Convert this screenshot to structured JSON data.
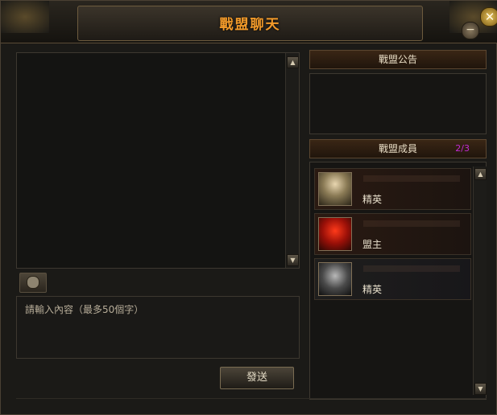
{
  "window": {
    "title": "戰盟聊天"
  },
  "chat": {
    "input_placeholder": "請輸入內容（最多50個字）",
    "send_label": "發送"
  },
  "notice": {
    "header": "戰盟公告"
  },
  "members": {
    "header": "戰盟成員",
    "count": "2/3",
    "list": [
      {
        "rank": "精英",
        "avatar": "female-knight-portrait"
      },
      {
        "rank": "盟主",
        "avatar": "red-demon-warrior-portrait"
      },
      {
        "rank": "精英",
        "avatar": "dark-armored-knight-portrait"
      }
    ]
  },
  "colors": {
    "title": "#f29a2a",
    "count": "#c32ad4",
    "panel": "#161513"
  },
  "icons": {
    "close": "close-icon",
    "minimize": "minimize-icon",
    "emoji": "emoji-icon",
    "up": "scroll-up-arrow-icon",
    "down": "scroll-down-arrow-icon"
  }
}
